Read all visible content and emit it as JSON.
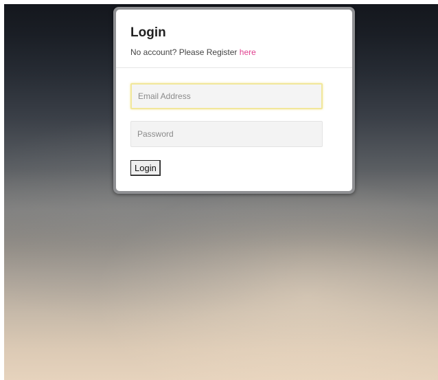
{
  "login": {
    "title": "Login",
    "subtitle_text": "No account? Please Register ",
    "register_link": "here",
    "email_placeholder": "Email Address",
    "email_value": "",
    "password_placeholder": "Password",
    "password_value": "",
    "submit_label": "Login"
  },
  "colors": {
    "link": "#e0418f",
    "focus_border": "#f1e79a"
  }
}
